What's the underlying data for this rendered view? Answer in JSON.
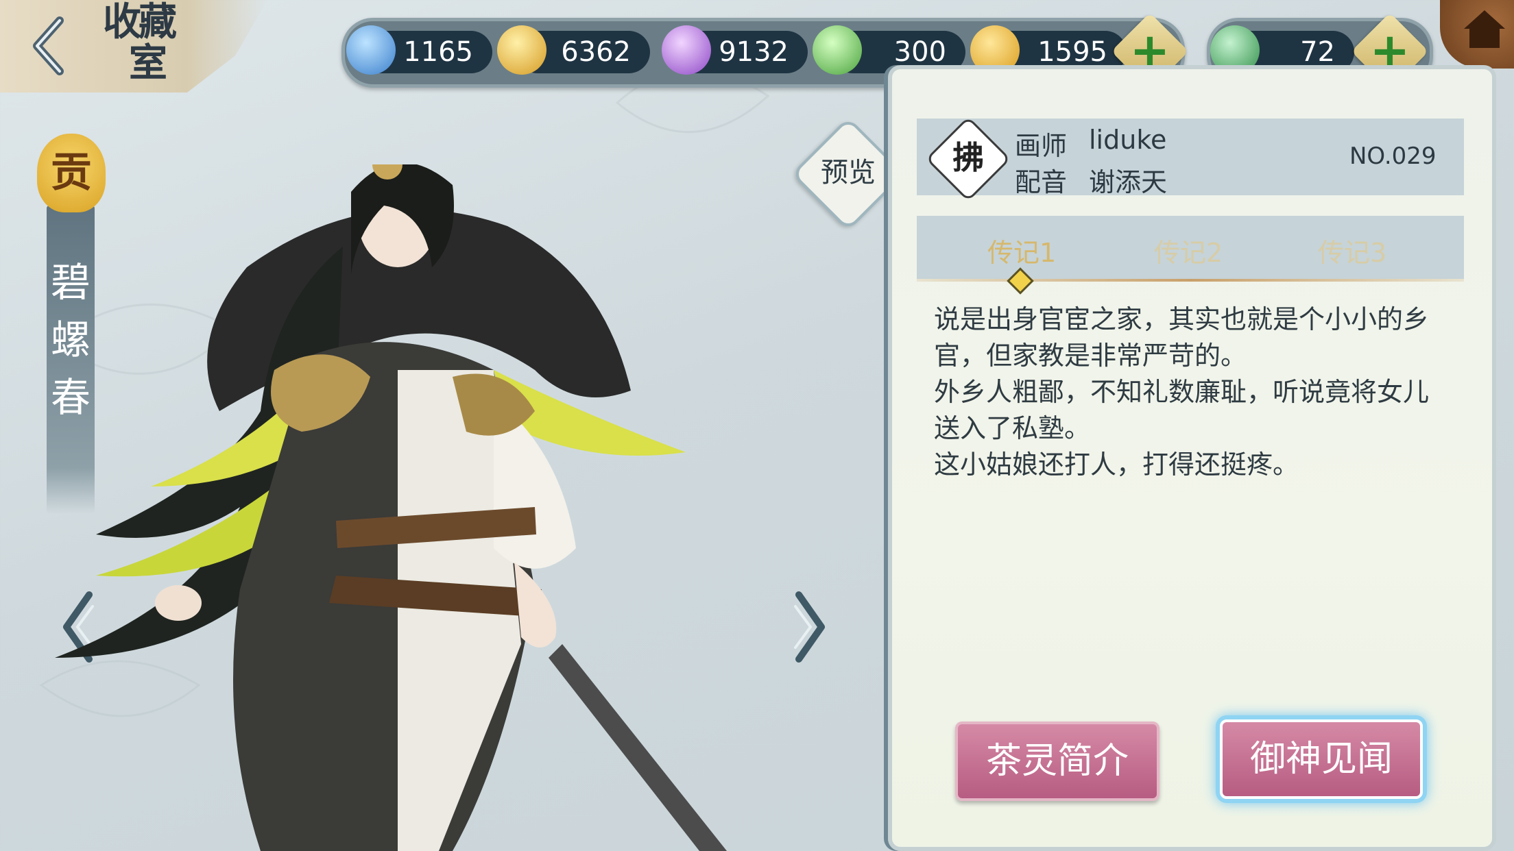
{
  "header": {
    "title_line1": "收藏",
    "title_line2": "室"
  },
  "resources": [
    {
      "name": "blue-gem",
      "value": "1165",
      "color": "#4a8fd6"
    },
    {
      "name": "gold-coin",
      "value": "6362",
      "color": "#e0b43a"
    },
    {
      "name": "purple-gem",
      "value": "9132",
      "color": "#a05bd0"
    },
    {
      "name": "green-gem",
      "value": "300",
      "color": "#58b94b"
    },
    {
      "name": "gold-leaf",
      "value": "1595",
      "color": "#e7b12a"
    }
  ],
  "secondary_resource": {
    "name": "green-swirl",
    "value": "72",
    "color": "#3fa356"
  },
  "character": {
    "grade": "贡",
    "name_chars": [
      "碧",
      "螺",
      "春"
    ]
  },
  "preview_label": "预览",
  "info": {
    "seal_char": "拂",
    "artist_label": "画师",
    "artist": "liduke",
    "voice_label": "配音",
    "voice": "谢添天",
    "number": "NO.029"
  },
  "tabs": [
    "传记1",
    "传记2",
    "传记3"
  ],
  "story": [
    "说是出身官宦之家，其实也就是个小小的乡",
    "官，但家教是非常严苛的。",
    "外乡人粗鄙，不知礼数廉耻，听说竟将女儿",
    "送入了私塾。",
    "这小姑娘还打人，打得还挺疼。"
  ],
  "buttons": {
    "intro": "茶灵简介",
    "story": "御神见闻"
  }
}
